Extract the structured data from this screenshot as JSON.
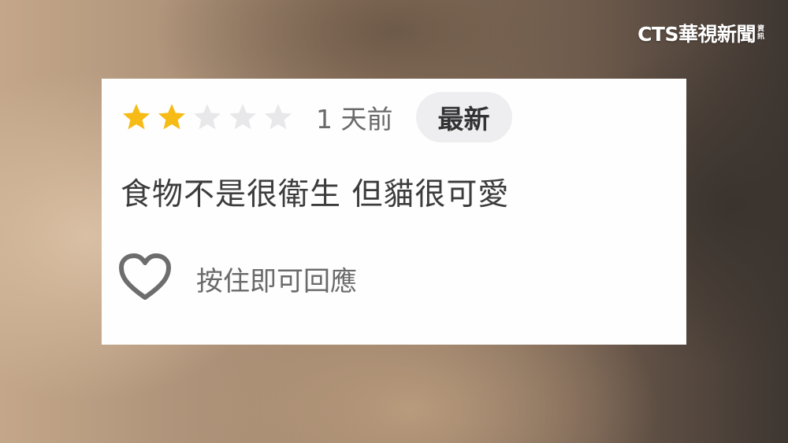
{
  "broadcaster": {
    "logo_main": "CTS華視新聞",
    "logo_side_top": "資",
    "logo_side_bottom": "訊"
  },
  "review": {
    "rating": 2,
    "max_rating": 5,
    "star_filled_color": "#f6bb15",
    "star_empty_color": "#e8e8ea",
    "time_ago": "1 天前",
    "badge_label": "最新",
    "text": "食物不是很衛生 但貓很可愛",
    "reply_hint": "按住即可回應",
    "heart_icon": "heart-outline-icon"
  }
}
